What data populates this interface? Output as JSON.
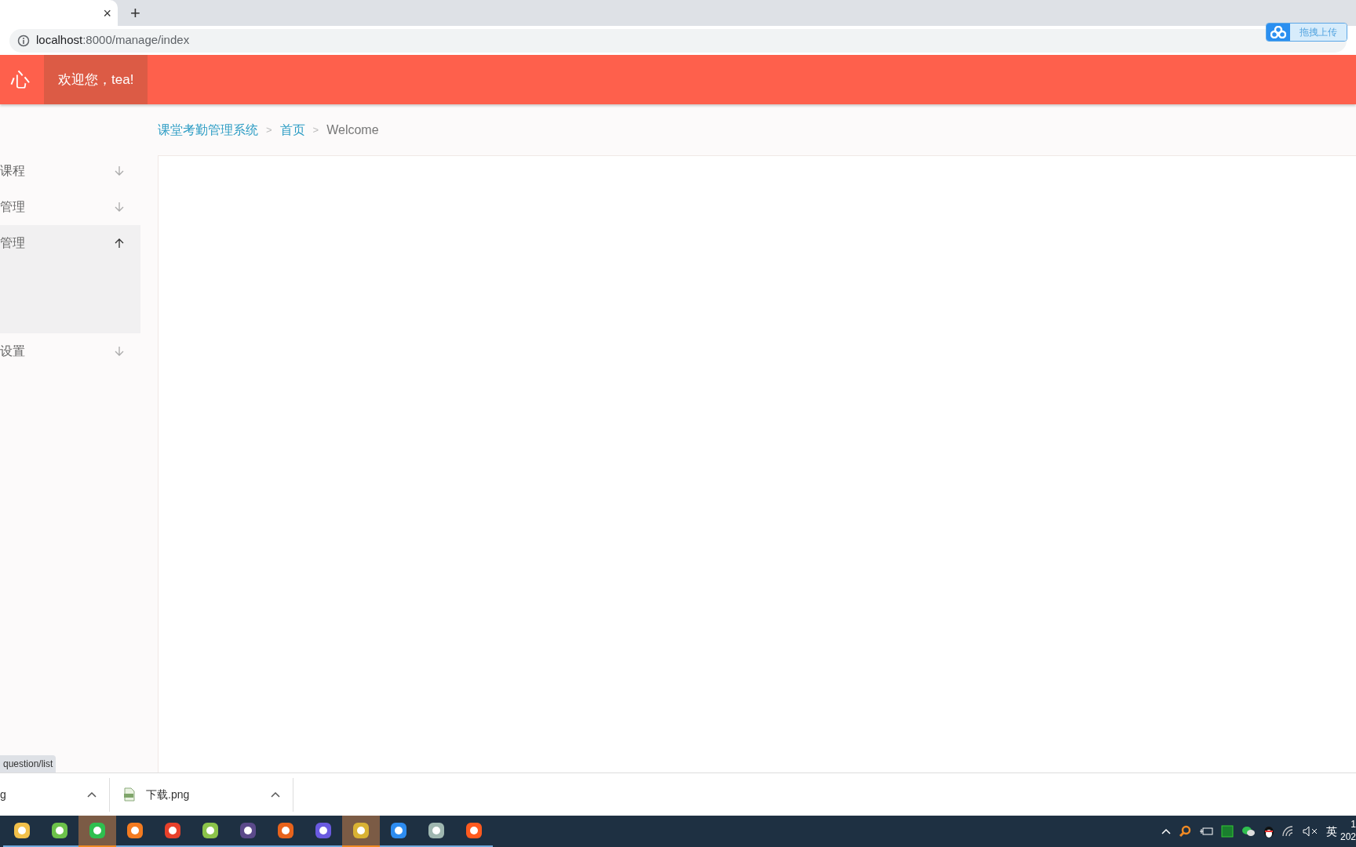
{
  "browser": {
    "tab_close": "×",
    "new_tab": "+",
    "url_host": "localhost",
    "url_path": ":8000/manage/index"
  },
  "upload_widget": {
    "label": "拖拽上传"
  },
  "header": {
    "title": "心",
    "greeting": "欢迎您，tea!"
  },
  "sidebar": {
    "items": [
      {
        "label": "课程",
        "expanded": false
      },
      {
        "label": "管理",
        "expanded": false
      },
      {
        "label": "管理",
        "expanded": true
      },
      {
        "label": "设置",
        "expanded": false
      }
    ]
  },
  "breadcrumb": [
    {
      "label": "课堂考勤管理系统",
      "kind": "link"
    },
    {
      "label": "首页",
      "kind": "link",
      "separator": ">"
    },
    {
      "label": "Welcome",
      "kind": "current",
      "separator": ">"
    }
  ],
  "status_link": "question/list",
  "downloads": [
    {
      "name": "g"
    },
    {
      "name": "下载.png"
    }
  ],
  "taskbar": {
    "apps": [
      {
        "color": "#f2c04a",
        "active": false
      },
      {
        "color": "#6cc24a",
        "active": false
      },
      {
        "color": "#2fbf4f",
        "active": true
      },
      {
        "color": "#f47b20",
        "active": false
      },
      {
        "color": "#e8402a",
        "active": false
      },
      {
        "color": "#8bc34a",
        "active": false
      },
      {
        "color": "#5b4a8a",
        "active": false
      },
      {
        "color": "#e8631c",
        "active": false
      },
      {
        "color": "#6a5ae0",
        "active": false
      },
      {
        "color": "#d9b233",
        "active": true
      },
      {
        "color": "#2d8cf0",
        "active": false
      },
      {
        "color": "#9fb7b0",
        "active": false
      },
      {
        "color": "#ff5a1f",
        "active": false
      }
    ],
    "ime": "英",
    "clock_time": "1",
    "clock_date": "202"
  }
}
